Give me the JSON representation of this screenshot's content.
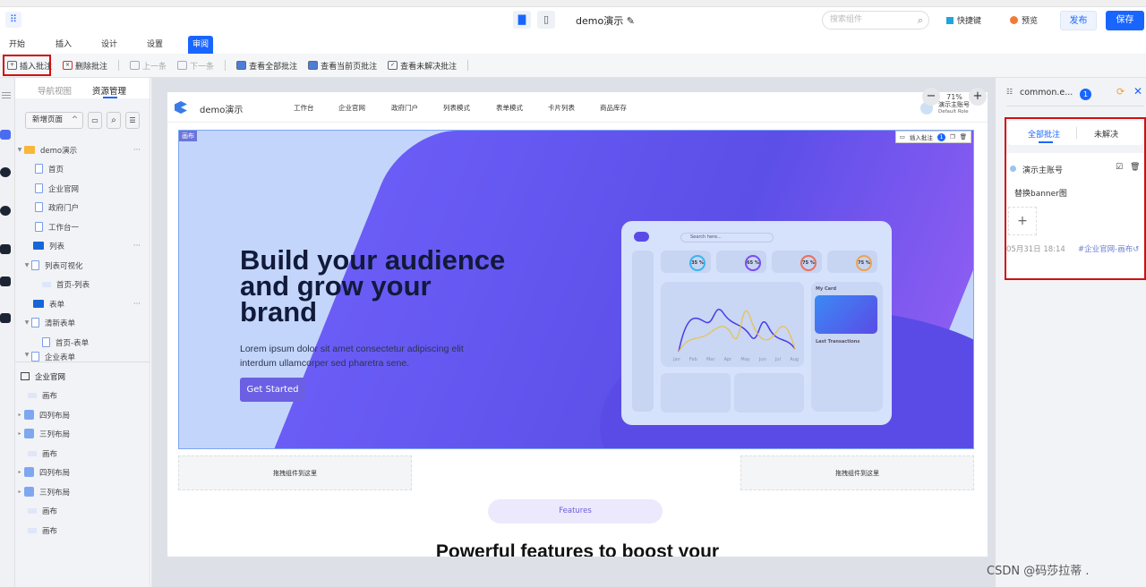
{
  "header": {
    "doc_title": "demo演示",
    "search_placeholder": "搜索组件",
    "shortcut_label": "快捷键",
    "preview_label": "预览",
    "publish_label": "发布",
    "save_label": "保存"
  },
  "menu_tabs": [
    "开始",
    "插入",
    "设计",
    "设置",
    "审阅"
  ],
  "toolbar": {
    "insert_comment": "插入批注",
    "delete_comment": "删除批注",
    "prev": "上一条",
    "next": "下一条",
    "view_all": "查看全部批注",
    "view_page": "查看当前页批注",
    "view_unresolved": "查看未解决批注"
  },
  "left_panel": {
    "tabs": [
      "导航视图",
      "资源管理"
    ],
    "new_page": "新增页面",
    "tree": [
      "demo演示",
      "首页",
      "企业官网",
      "政府门户",
      "工作台一",
      "列表",
      "列表可视化",
      "首页-列表",
      "表单",
      "清新表单",
      "首页-表单",
      "企业表单"
    ],
    "layers_title": "企业官网",
    "layers": [
      "画布",
      "四列布局",
      "三列布局",
      "画布",
      "四列布局",
      "三列布局",
      "画布",
      "画布"
    ]
  },
  "page": {
    "brand": "demo演示",
    "nav": [
      "工作台",
      "企业官网",
      "政府门户",
      "列表模式",
      "表单模式",
      "卡片列表",
      "商品库存"
    ],
    "user_name": "演示主账号",
    "user_role": "Default Role",
    "zoom": "71%",
    "canvas_tag": "画布",
    "insert_comment": "插入批注",
    "comment_count": "1",
    "hero_title": "Build your audience and grow your brand",
    "hero_text": "Lorem ipsum dolor sit amet consectetur adipiscing elit interdum ullamcorper sed pharetra sene.",
    "cta": "Get Started",
    "dashboard": {
      "search": "Search here...",
      "gauges": [
        "35 %",
        "65 %",
        "75 %",
        "75 %"
      ],
      "my_card": "My Card",
      "last_tx": "Last Transactions",
      "months": [
        "Jan",
        "Feb",
        "Mar",
        "Apr",
        "May",
        "Jun",
        "Jul",
        "Aug"
      ]
    },
    "drop_label": "拖拽组件到这里",
    "features": "Features",
    "section_title": "Powerful features to boost your"
  },
  "right_panel": {
    "title": "common.e...",
    "count": "1",
    "tabs": [
      "全部批注",
      "未解决"
    ],
    "author": "演示主账号",
    "comment": "替换banner图",
    "time": "05月31日 18:14",
    "link": "#企业官网-画布"
  },
  "watermark": "CSDN @码莎拉蒂 ."
}
